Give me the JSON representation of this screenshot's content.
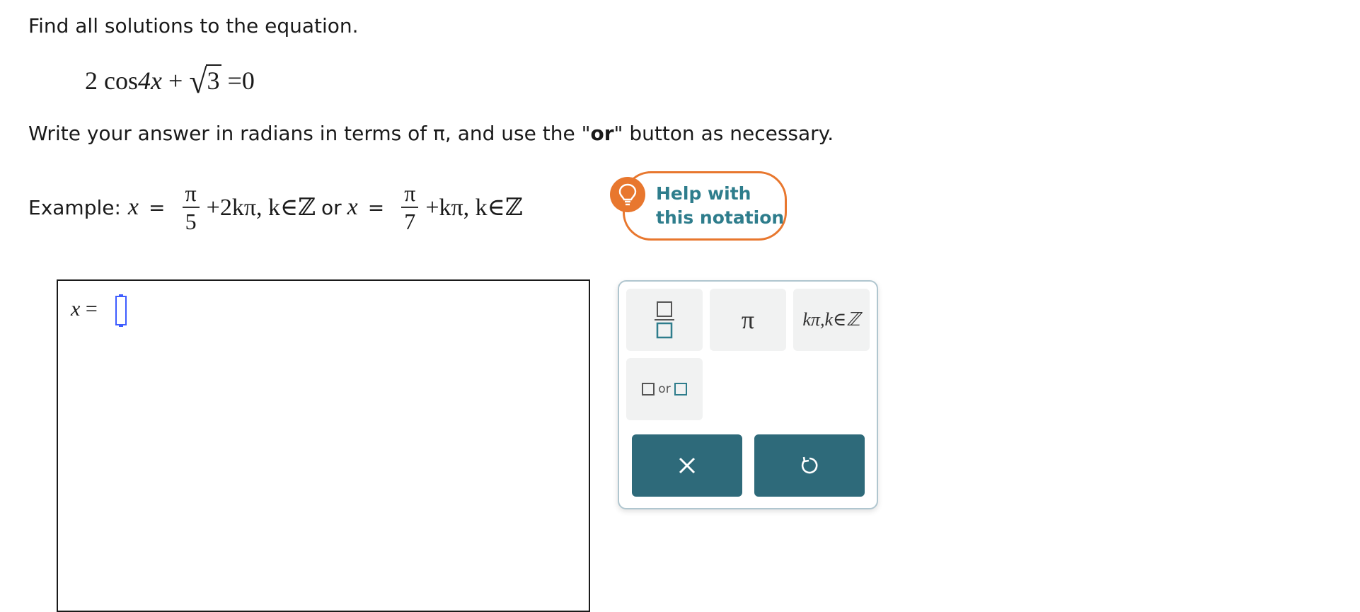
{
  "question": {
    "instruction": "Find all solutions to the equation.",
    "equation": {
      "coef": "2",
      "func": "cos",
      "arg": "4x",
      "plus": "+",
      "radicand": "3",
      "equals": "=0"
    },
    "directions_before": "Write your answer in radians in terms of π, and use the \"",
    "directions_bold": "or",
    "directions_after": "\" button as necessary."
  },
  "example": {
    "label": "Example:",
    "var": "x",
    "eq": "=",
    "frac1_num": "π",
    "frac1_den": "5",
    "term1": "+2kπ, k∈ℤ",
    "or_text": "or",
    "frac2_num": "π",
    "frac2_den": "7",
    "term2": "+kπ, k∈ℤ"
  },
  "help_button": {
    "line1": "Help with",
    "line2": "this notation"
  },
  "answer": {
    "label": "x =",
    "value": ""
  },
  "palette": {
    "pi_key": "π",
    "kpi_key": "kπ,k∈ℤ",
    "or_key_text": "or",
    "clear_icon": "close-icon",
    "undo_icon": "undo-icon"
  },
  "colors": {
    "accent_orange": "#e8772e",
    "teal_text": "#2e7d8c",
    "action_bg": "#2e6a7a",
    "key_bg": "#f1f2f2",
    "cursor_blue": "#3d5cff"
  }
}
